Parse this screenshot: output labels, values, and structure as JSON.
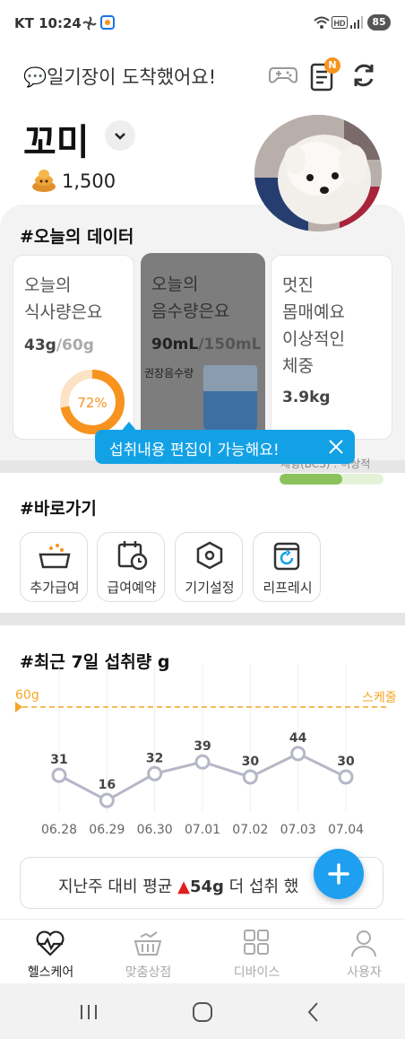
{
  "status_bar": {
    "carrier_time": "KT 10:24",
    "battery": "85"
  },
  "header": {
    "title": "💬일기장이 도착했어요!",
    "notification_badge": "N"
  },
  "pet": {
    "name": "꼬미",
    "coins": "1,500"
  },
  "today": {
    "section_title": "#오늘의 데이터",
    "food_card": {
      "title_line1": "오늘의",
      "title_line2": "식사량은요",
      "value": "43g",
      "goal": "/60g",
      "percent": "72%",
      "progress": 0.72
    },
    "water_card": {
      "title_line1": "오늘의",
      "title_line2": "음수량은요",
      "value": "90mL",
      "goal": "/150mL",
      "recommended_label": "권장음수량",
      "level": 0.6
    },
    "weight_card": {
      "title_line1": "멋진",
      "title_line2": "몸매예요",
      "title_line3": "이상적인",
      "title_line4": "체중",
      "value": "3.9kg",
      "bcs_label": "체형(BCS) : 이상적",
      "bcs_level": 0.6
    },
    "tooltip": "섭취내용 편집이 가능해요!"
  },
  "shortcuts": {
    "section_title": "#바로가기",
    "items": [
      {
        "label": "추가급여"
      },
      {
        "label": "급여예약"
      },
      {
        "label": "기기설정"
      },
      {
        "label": "리프레시"
      }
    ]
  },
  "weekly": {
    "section_title": "#최근 7일 섭취량 g",
    "goal_label": "60g",
    "scale_label": "스케줄",
    "summary_prefix": "지난주 대비 평균",
    "summary_value": "54g",
    "summary_suffix": "더 섭취 했",
    "colors": {
      "line": "#b5b7c6",
      "goal": "#f5a623",
      "up_arrow": "#e02020",
      "accent": "#13a1e6"
    }
  },
  "chart_data": {
    "type": "line",
    "title": "#최근 7일 섭취량 g",
    "x": [
      "06.28",
      "06.29",
      "06.30",
      "07.01",
      "07.02",
      "07.03",
      "07.04"
    ],
    "series": [
      {
        "values": [
          31,
          16,
          32,
          39,
          30,
          44,
          30
        ]
      }
    ],
    "reference_line": {
      "label": "60g",
      "value": 60
    },
    "grid": false
  },
  "nav": {
    "items": [
      {
        "label": "헬스케어",
        "icon": "heartbeat-icon",
        "active": true
      },
      {
        "label": "맞춤상점",
        "icon": "shopping-basket-icon",
        "active": false
      },
      {
        "label": "디바이스",
        "icon": "grid-icon",
        "active": false
      },
      {
        "label": "사용자",
        "icon": "user-icon",
        "active": false
      }
    ]
  }
}
